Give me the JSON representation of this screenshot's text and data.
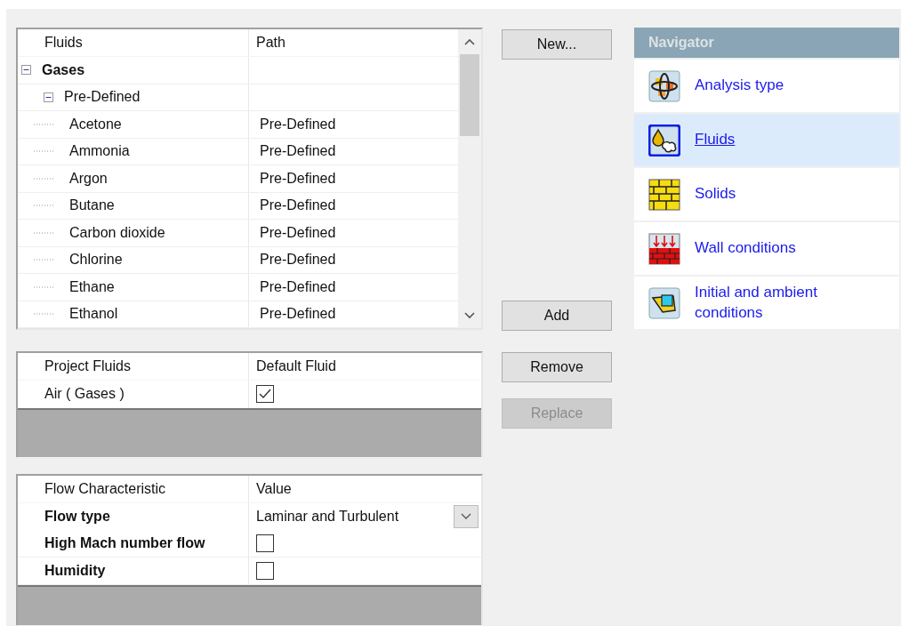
{
  "fluids_tree": {
    "columns": [
      "Fluids",
      "Path"
    ],
    "items": [
      {
        "label": "Gases",
        "expanded": true,
        "children": [
          {
            "label": "Pre-Defined",
            "expanded": true,
            "children": [
              {
                "label": "Acetone",
                "path": "Pre-Defined"
              },
              {
                "label": "Ammonia",
                "path": "Pre-Defined"
              },
              {
                "label": "Argon",
                "path": "Pre-Defined"
              },
              {
                "label": "Butane",
                "path": "Pre-Defined"
              },
              {
                "label": "Carbon dioxide",
                "path": "Pre-Defined"
              },
              {
                "label": "Chlorine",
                "path": "Pre-Defined"
              },
              {
                "label": "Ethane",
                "path": "Pre-Defined"
              },
              {
                "label": "Ethanol",
                "path": "Pre-Defined"
              }
            ]
          }
        ]
      }
    ]
  },
  "new_button": {
    "label": "New...",
    "disabled": false
  },
  "add_button": {
    "label": "Add",
    "disabled": false
  },
  "remove_button": {
    "label": "Remove",
    "disabled": false
  },
  "replace_button": {
    "label": "Replace",
    "disabled": true
  },
  "project_fluids": {
    "columns": [
      "Project Fluids",
      "Default Fluid"
    ],
    "rows": [
      {
        "name": "Air ( Gases )",
        "default": true
      }
    ]
  },
  "flow_characteristics": {
    "columns": [
      "Flow Characteristic",
      "Value"
    ],
    "rows": [
      {
        "kind": "dropdown",
        "name": "Flow type",
        "value": "Laminar and Turbulent"
      },
      {
        "kind": "checkbox",
        "name": "High Mach number flow",
        "checked": false
      },
      {
        "kind": "checkbox",
        "name": "Humidity",
        "checked": false
      }
    ]
  },
  "navigator": {
    "title": "Navigator",
    "items": [
      {
        "label": "Analysis type",
        "selected": false
      },
      {
        "label": "Fluids",
        "selected": true
      },
      {
        "label": "Solids",
        "selected": false
      },
      {
        "label": "Wall conditions",
        "selected": false
      },
      {
        "label": "Initial and ambient conditions",
        "selected": false
      }
    ]
  }
}
